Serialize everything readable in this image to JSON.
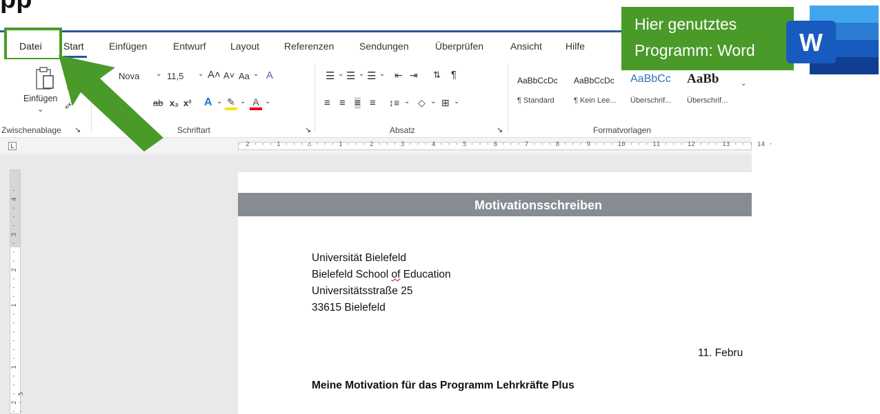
{
  "slide": {
    "title": "pp"
  },
  "tabs": [
    "Start",
    "Einfügen",
    "Entwurf",
    "Layout",
    "Referenzen",
    "Sendungen",
    "Überprüfen",
    "Ansicht",
    "Hilfe"
  ],
  "file_tab": "Datei",
  "ribbon": {
    "paste_label": "Einfügen",
    "paste_more": "⌄",
    "font_name": "Nova",
    "font_size": "11,5",
    "case_button": "Aa",
    "groups": {
      "clipboard": "Zwischenablage",
      "font": "Schriftart",
      "paragraph": "Absatz",
      "styles": "Formatvorlagen"
    },
    "styles": [
      {
        "sample": "AaBbCcDc",
        "name": "¶ Standard"
      },
      {
        "sample": "AaBbCcDc",
        "name": "¶ Kein Lee..."
      },
      {
        "sample": "AaBbCc",
        "name": "Überschrif..."
      },
      {
        "sample": "AaBb",
        "name": "Überschrif..."
      }
    ]
  },
  "ruler": {
    "horizontal": "· 2 · · · 1 · · · ⌂ · · · 1 · · · 2 · · · 3 · · · 4 · · · 5 · · · 6 · · · 7 · · · 8 · · · 9 · · · 10 · · · 11 · · · 12 · · · 13 · · · 14 ·",
    "vertical": "· 2 · · · 1 · · · · · · 1 · · · 2 · · · 3 · · · 4 · · · 5"
  },
  "document": {
    "heading": "Motivationsschreiben",
    "address": [
      "Universität Bielefeld",
      "Bielefeld School of Education",
      "Universitätsstraße 25",
      "33615 Bielefeld"
    ],
    "address_line2_parts": {
      "before": "Bielefeld School ",
      "error": "of",
      "after": " Education"
    },
    "date": "11. Febru",
    "subject": "Meine Motivation für das Programm Lehrkräfte Plus"
  },
  "callout": {
    "line1": "Hier genutztes",
    "line2": "Programm: Word"
  },
  "logo": {
    "letter": "W"
  },
  "colors": {
    "callout": "#4a9a2a",
    "accent": "#2b579a",
    "banner": "#878c93"
  }
}
